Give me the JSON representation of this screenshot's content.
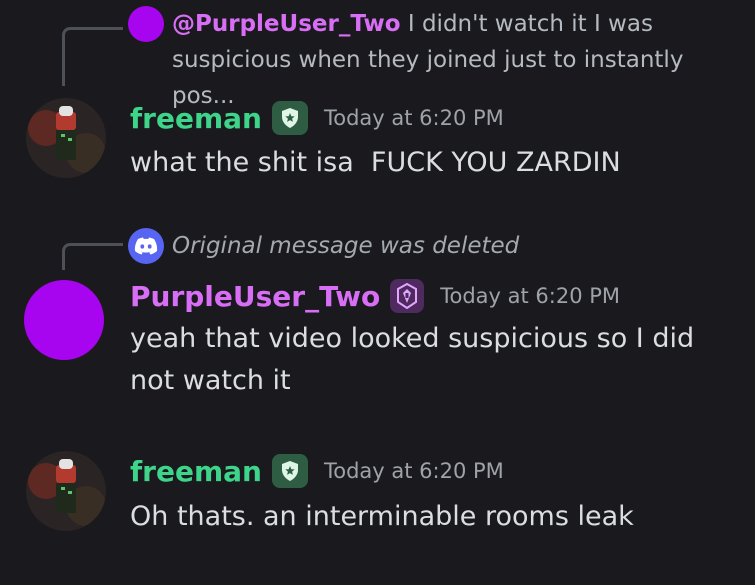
{
  "colors": {
    "background": "#1a1a1e",
    "freeman_name": "#3ed48a",
    "purple_name": "#d86ef5",
    "purple_avatar": "#a705f0",
    "discord_blurple": "#5865f2"
  },
  "messages": [
    {
      "reply": {
        "username": "@PurpleUser_Two",
        "text": "I didn't watch it I was suspicious when they joined just to instantly pos..."
      },
      "username": "freeman",
      "badge": "shield-star-icon",
      "timestamp": "Today at 6:20 PM",
      "text": "what the shit isa  FUCK YOU ZARDIN"
    },
    {
      "reply": {
        "deleted_text": "Original message was deleted"
      },
      "username": "PurpleUser_Two",
      "badge": "crest-icon",
      "timestamp": "Today at 6:20 PM",
      "text": "yeah that video looked suspicious so I did not watch it"
    },
    {
      "username": "freeman",
      "badge": "shield-star-icon",
      "timestamp": "Today at 6:20 PM",
      "text": "Oh thats. an interminable rooms leak"
    }
  ]
}
